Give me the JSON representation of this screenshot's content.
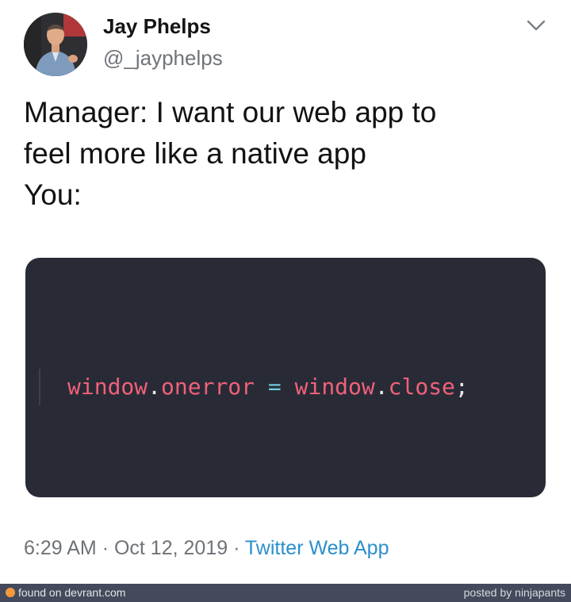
{
  "tweet": {
    "author_name": "Jay Phelps",
    "author_handle": "@_jayphelps",
    "text_lines": [
      "Manager: I want our web app to",
      "feel more like a native app",
      "You:"
    ],
    "code": {
      "left_ident": "window",
      "left_prop": "onerror",
      "operator": "=",
      "right_ident": "window",
      "right_prop": "close",
      "dot": ".",
      "semicolon": ";"
    },
    "time": "6:29 AM",
    "separator1": "·",
    "date": "Oct 12, 2019",
    "separator2": "·",
    "source": "Twitter Web App"
  },
  "footer": {
    "left_text": "found on devrant.com",
    "right_text": "posted by ninjapants"
  },
  "colors": {
    "code_background": "#282b36",
    "code_identifier": "#f2607a",
    "code_operator": "#6fc9d9",
    "link": "#2a8fcc",
    "footer_background": "#444a5b",
    "devrant_brand": "#f49a3c"
  },
  "icons": {
    "caret": "chevron-down-icon",
    "devrant": "devrant-logo-icon"
  }
}
